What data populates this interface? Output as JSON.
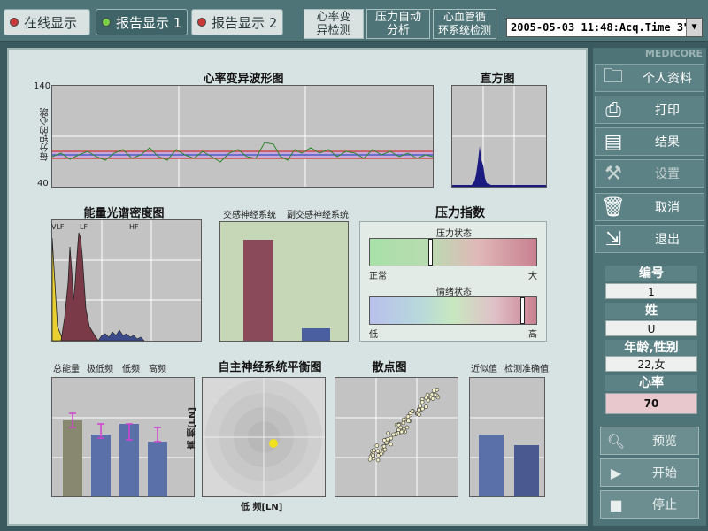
{
  "top_bar": {
    "mode_tabs": [
      {
        "label": "在线显示",
        "led": "#c83a3a"
      },
      {
        "label": "报告显示 1",
        "led": "#7ad04a"
      },
      {
        "label": "报告显示 2",
        "led": "#c83a3a"
      }
    ],
    "func_tabs": [
      {
        "line1": "心率变",
        "line2": "异检测"
      },
      {
        "line1": "压力自动",
        "line2": "分析"
      },
      {
        "line1": "心血管循",
        "line2": "环系统检测"
      }
    ],
    "time_select": "2005-05-03 11:48:Acq.Time   3\""
  },
  "hrv_waveform": {
    "title": "心率变异波形图",
    "ylabel": "每分钟的心跳",
    "ymax_label": "140",
    "ymin_label": "40"
  },
  "histogram": {
    "title": "直方图"
  },
  "psd": {
    "title": "能量光谱密度图",
    "band_labels": [
      "VLF",
      "LF",
      "HF"
    ]
  },
  "ans_activity": {
    "labels": [
      "交感神经系统",
      "副交感神经系统"
    ]
  },
  "stress_index": {
    "title": "压力指数",
    "stress_state": {
      "label": "压力状态",
      "left": "正常",
      "right": "大",
      "level": 0.36
    },
    "emotion_state": {
      "label": "情绪状态",
      "left": "低",
      "right": "高",
      "level": 0.91
    }
  },
  "power_bars": {
    "labels": [
      "总能量",
      "极低频",
      "低频",
      "高频"
    ]
  },
  "ans_balance": {
    "title": "自主神经系统平衡图",
    "xlabel": "低  频[LN]",
    "ylabel": "高  频[LN]"
  },
  "scatter": {
    "title": "散点图"
  },
  "accuracy": {
    "labels": [
      "近似值",
      "检测准确值"
    ]
  },
  "sidebar": {
    "brand": "MEDICORE",
    "buttons": [
      {
        "label": "个人资料",
        "icon": "folder-icon"
      },
      {
        "label": "打印",
        "icon": "printer-icon"
      },
      {
        "label": "结果",
        "icon": "result-icon"
      },
      {
        "label": "设置",
        "icon": "settings-icon"
      },
      {
        "label": "取消",
        "icon": "trash-icon"
      },
      {
        "label": "退出",
        "icon": "exit-icon"
      }
    ],
    "info": [
      {
        "label": "编号",
        "value": "1"
      },
      {
        "label": "姓",
        "value": "U"
      },
      {
        "label": "年龄,性别",
        "value": "22,女"
      },
      {
        "label": "心率",
        "value": "70"
      }
    ],
    "bottom_buttons": [
      {
        "label": "预览",
        "icon": "magnifier-icon"
      },
      {
        "label": "开始",
        "icon": "play-icon"
      },
      {
        "label": "停止",
        "icon": "stop-icon"
      }
    ]
  },
  "colors": {
    "main_panel": "#d7e3e2",
    "sidebar": "#4f7478",
    "bar_red": "#8a4a5a",
    "bar_blue": "#4a5fa0",
    "heart_rate_bg": "#e8c8cc"
  }
}
